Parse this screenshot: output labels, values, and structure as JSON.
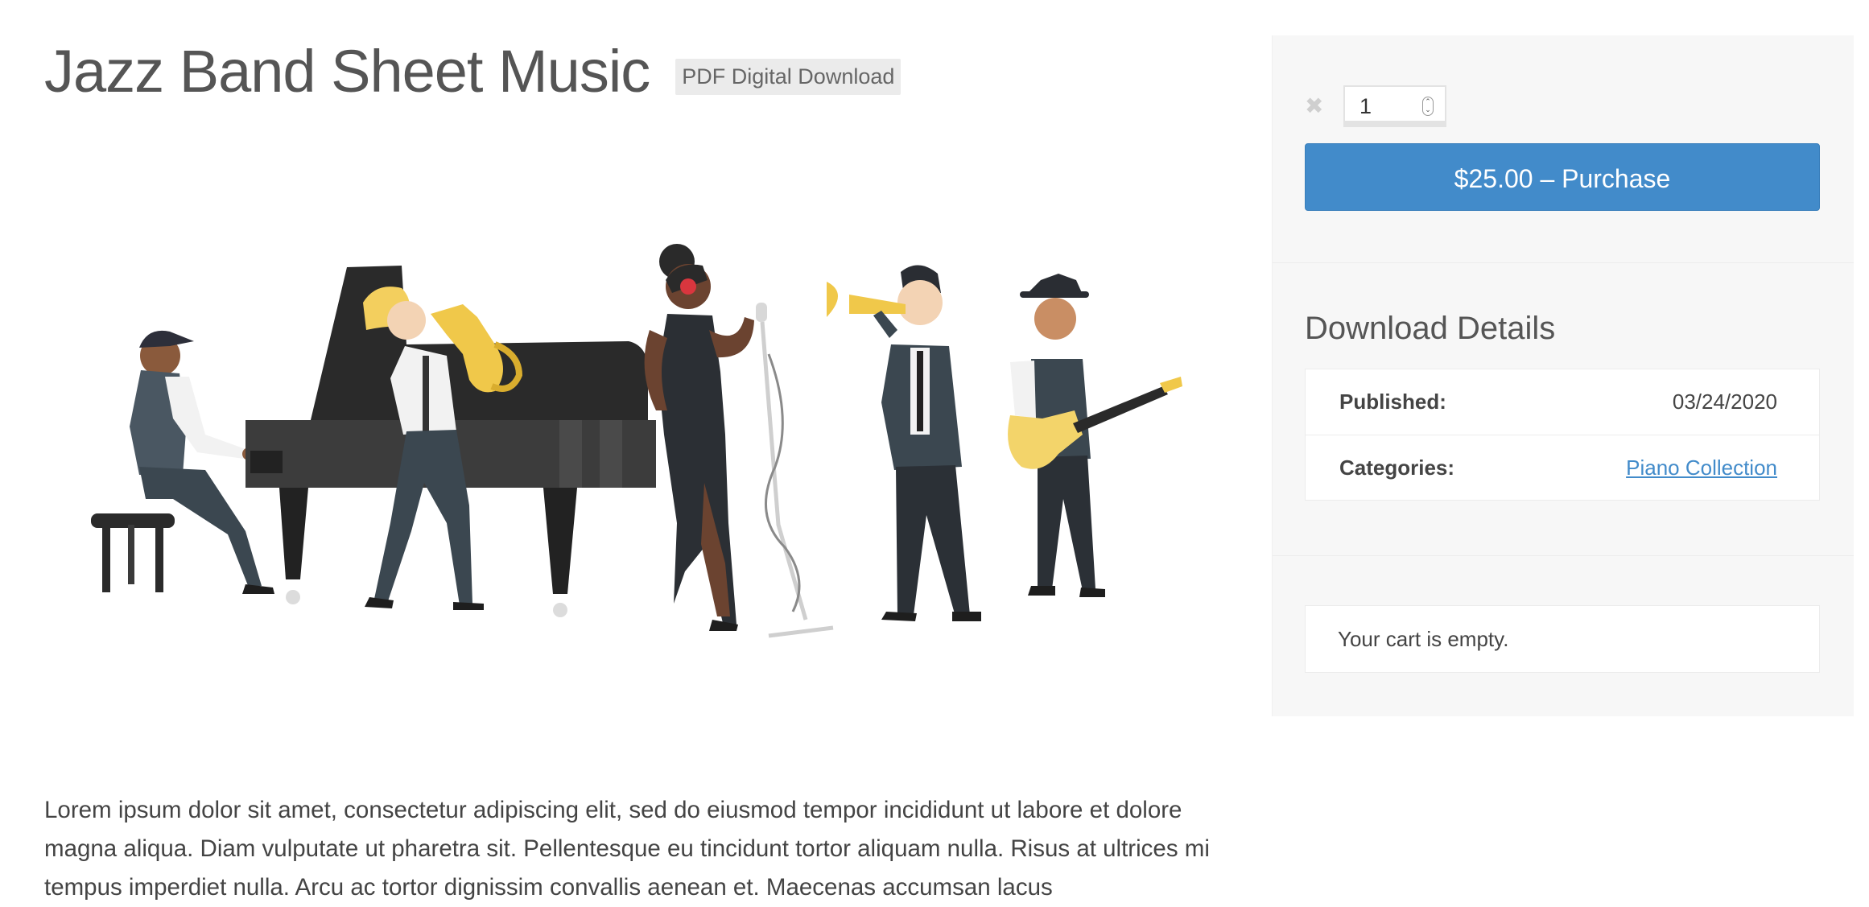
{
  "product": {
    "title": "Jazz Band Sheet Music",
    "badge": "PDF Digital Download",
    "hero_image_alt": "Jazz band illustration",
    "description": "Lorem ipsum dolor sit amet, consectetur adipiscing elit, sed do eiusmod tempor incididunt ut labore et dolore magna aliqua. Diam vulputate ut pharetra sit. Pellentesque eu tincidunt tortor aliquam nulla. Risus at ultrices mi tempus imperdiet nulla. Arcu ac tortor dignissim convallis aenean et. Maecenas accumsan lacus"
  },
  "purchase": {
    "remove_icon": "✖",
    "quantity": "1",
    "button_label": "$25.00 – Purchase",
    "button_color": "#428bca"
  },
  "details": {
    "title": "Download Details",
    "rows": [
      {
        "label": "Published:",
        "value": "03/24/2020"
      },
      {
        "label": "Categories:",
        "value": "Piano Collection"
      }
    ]
  },
  "cart": {
    "message": "Your cart is empty."
  }
}
